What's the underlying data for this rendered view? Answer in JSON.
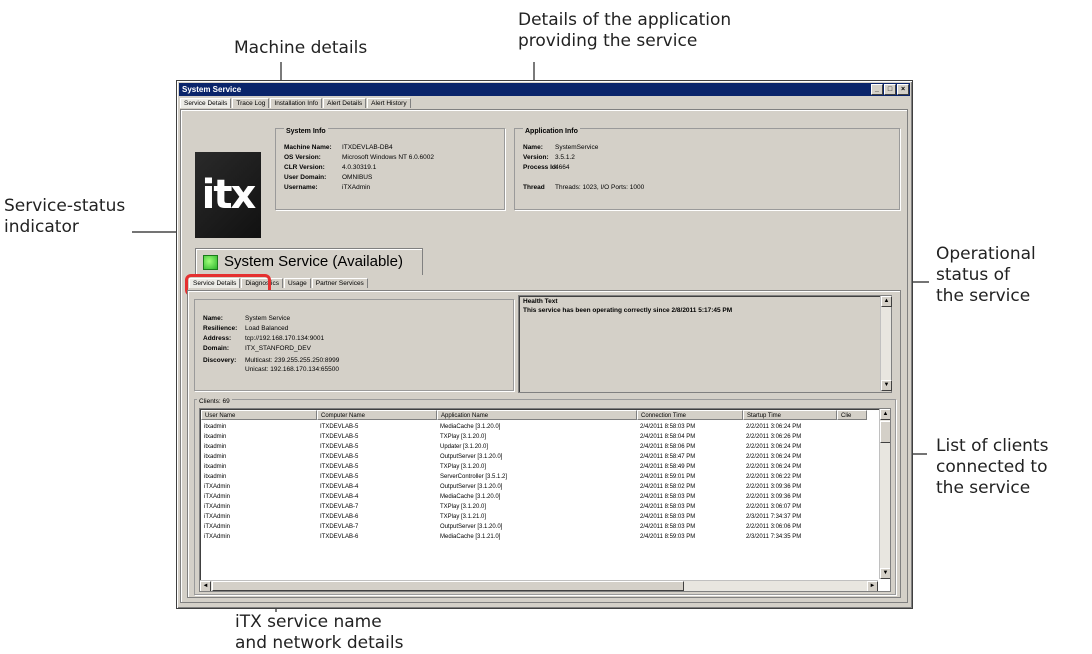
{
  "callouts": {
    "machine_details": "Machine details",
    "app_details_line1": "Details of the application",
    "app_details_line2": "providing the service",
    "status_indicator_line1": "Service-status",
    "status_indicator_line2": "indicator",
    "operational_line1": "Operational",
    "operational_line2": "status of",
    "operational_line3": "the service",
    "clients_line1": "List of clients",
    "clients_line2": "connected to",
    "clients_line3": "the service",
    "service_name_line1": "iTX service name",
    "service_name_line2": "and network details"
  },
  "window": {
    "title": "System Service",
    "minimize": "_",
    "maximize": "□",
    "close": "×"
  },
  "top_tabs": [
    "Service Details",
    "Trace Log",
    "Installation Info",
    "Alert Details",
    "Alert History"
  ],
  "logo_text": "itx",
  "system_info": {
    "title": "System Info",
    "machine_name_label": "Machine Name:",
    "machine_name": "ITXDEVLAB-DB4",
    "os_version_label": "OS Version:",
    "os_version": "Microsoft Windows NT 6.0.6002",
    "clr_version_label": "CLR Version:",
    "clr_version": "4.0.30319.1",
    "user_domain_label": "User Domain:",
    "user_domain": "OMNIBUS",
    "username_label": "Username:",
    "username": "iTXAdmin"
  },
  "application_info": {
    "title": "Application Info",
    "name_label": "Name:",
    "name": "SystemService",
    "version_label": "Version:",
    "version": "3.5.1.2",
    "process_id_label": "Process Id:",
    "process_id": "4664",
    "thread_label": "Thread",
    "thread": "Threads: 1023, I/O Ports: 1000"
  },
  "service_header": "System Service (Available)",
  "inner_tabs": [
    "Service Details",
    "Diagnostics",
    "Usage",
    "Partner Services"
  ],
  "service_details": {
    "name_label": "Name:",
    "name": "System Service",
    "resilience_label": "Resilience:",
    "resilience": "Load Balanced",
    "address_label": "Address:",
    "address": "tcp://192.168.170.134:9001",
    "domain_label": "Domain:",
    "domain": "ITX_STANFORD_DEV",
    "discovery_label": "Discovery:",
    "discovery_multicast": "Multicast: 239.255.255.250:8999",
    "discovery_unicast": "Unicast: 192.168.170.134:65500"
  },
  "health": {
    "title": "Health Text",
    "text": "This service has been operating correctly since 2/8/2011 5:17:45 PM"
  },
  "clients": {
    "title": "Clients: 69",
    "columns": [
      "User Name",
      "Computer Name",
      "Application Name",
      "Connection Time",
      "Startup Time",
      "Clie"
    ],
    "rows": [
      [
        "itxadmin",
        "ITXDEVLAB-5",
        "MediaCache [3.1.20.0]",
        "2/4/2011 8:58:03 PM",
        "2/2/2011 3:06:24 PM"
      ],
      [
        "itxadmin",
        "ITXDEVLAB-5",
        "TXPlay [3.1.20.0]",
        "2/4/2011 8:58:04 PM",
        "2/2/2011 3:06:26 PM"
      ],
      [
        "itxadmin",
        "ITXDEVLAB-5",
        "Updater [3.1.20.0]",
        "2/4/2011 8:58:06 PM",
        "2/2/2011 3:06:24 PM"
      ],
      [
        "itxadmin",
        "ITXDEVLAB-5",
        "OutputServer [3.1.20.0]",
        "2/4/2011 8:58:47 PM",
        "2/2/2011 3:06:24 PM"
      ],
      [
        "itxadmin",
        "ITXDEVLAB-5",
        "TXPlay [3.1.20.0]",
        "2/4/2011 8:58:49 PM",
        "2/2/2011 3:06:24 PM"
      ],
      [
        "itxadmin",
        "ITXDEVLAB-5",
        "ServerController [3.5.1.2]",
        "2/4/2011 8:59:01 PM",
        "2/2/2011 3:06:22 PM"
      ],
      [
        "iTXAdmin",
        "ITXDEVLAB-4",
        "OutputServer [3.1.20.0]",
        "2/4/2011 8:58:02 PM",
        "2/2/2011 3:09:36 PM"
      ],
      [
        "iTXAdmin",
        "ITXDEVLAB-4",
        "MediaCache [3.1.20.0]",
        "2/4/2011 8:58:03 PM",
        "2/2/2011 3:09:36 PM"
      ],
      [
        "iTXAdmin",
        "ITXDEVLAB-7",
        "TXPlay [3.1.20.0]",
        "2/4/2011 8:58:03 PM",
        "2/2/2011 3:06:07 PM"
      ],
      [
        "iTXAdmin",
        "ITXDEVLAB-6",
        "TXPlay [3.1.21.0]",
        "2/4/2011 8:58:03 PM",
        "2/3/2011 7:34:37 PM"
      ],
      [
        "iTXAdmin",
        "ITXDEVLAB-7",
        "OutputServer [3.1.20.0]",
        "2/4/2011 8:58:03 PM",
        "2/2/2011 3:06:06 PM"
      ],
      [
        "iTXAdmin",
        "ITXDEVLAB-6",
        "MediaCache [3.1.21.0]",
        "2/4/2011 8:59:03 PM",
        "2/3/2011 7:34:35 PM"
      ]
    ]
  }
}
